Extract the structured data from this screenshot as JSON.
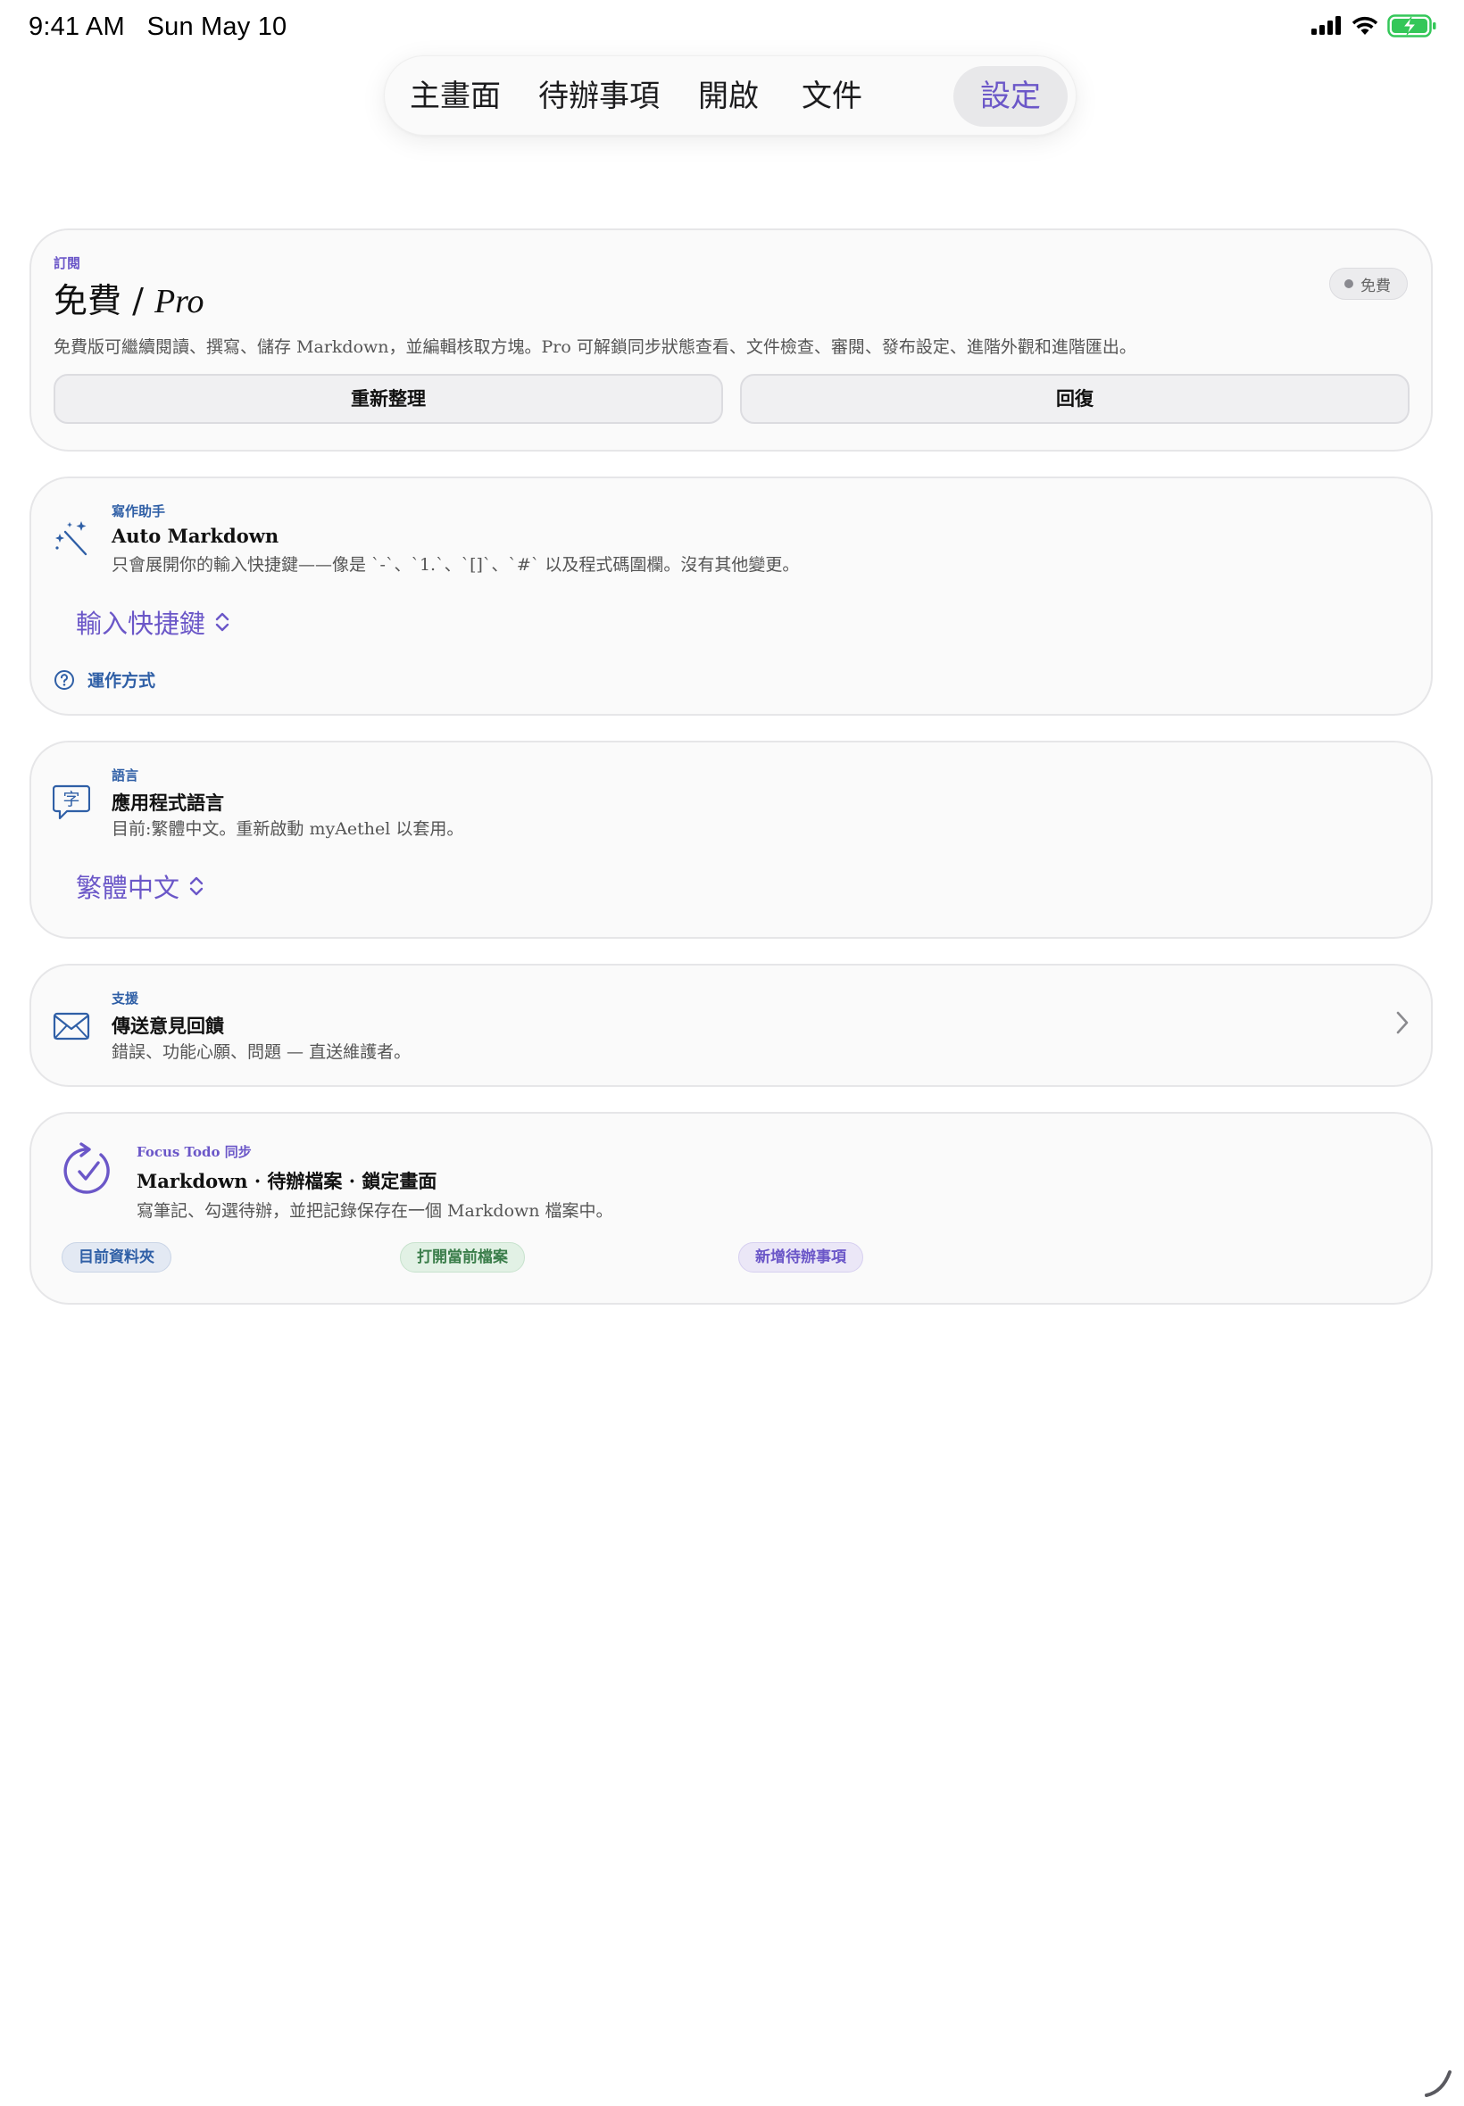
{
  "status_bar": {
    "time": "9:41 AM",
    "date": "Sun May 10"
  },
  "tabs": [
    {
      "label": "主畫面",
      "active": false
    },
    {
      "label": "待辦事項",
      "active": false
    },
    {
      "label": "開啟",
      "active": false
    },
    {
      "label": "文件",
      "active": false
    },
    {
      "label": "設定",
      "active": true
    }
  ],
  "subscription": {
    "eyebrow": "訂閱",
    "title_main": "免費 / ",
    "title_pro": "Pro",
    "badge": "免費",
    "description": "免費版可繼續閱讀、撰寫、儲存 Markdown，並編輯核取方塊。Pro 可解鎖同步狀態查看、文件檢查、審閱、發布設定、進階外觀和進階匯出。",
    "refresh_button": "重新整理",
    "restore_button": "回復"
  },
  "writing_assistant": {
    "eyebrow": "寫作助手",
    "title": "Auto Markdown",
    "description": "只會展開你的輸入快捷鍵——像是 `-`、`1.`、`[]`、`#` 以及程式碼圍欄。沒有其他變更。",
    "picker_value": "輸入快捷鍵",
    "how_it_works": "運作方式"
  },
  "language": {
    "eyebrow": "語言",
    "title": "應用程式語言",
    "description": "目前:繁體中文。重新啟動 myAethel 以套用。",
    "picker_value": "繁體中文",
    "icon_glyph": "字"
  },
  "support": {
    "eyebrow": "支援",
    "title": "傳送意見回饋",
    "description": "錯誤、功能心願、問題 — 直送維護者。"
  },
  "focus_todo": {
    "eyebrow": "Focus Todo 同步",
    "title": "Markdown · 待辦檔案 · 鎖定畫面",
    "description": "寫筆記、勾選待辦，並把記錄保存在一個 Markdown 檔案中。",
    "pills": [
      "目前資料夾",
      "打開當前檔案",
      "新增待辦事項"
    ]
  },
  "colors": {
    "accent_purple": "#6b57c8",
    "accent_blue": "#2f5fa6",
    "green": "#3a7d4a",
    "battery_green": "#34c759"
  }
}
